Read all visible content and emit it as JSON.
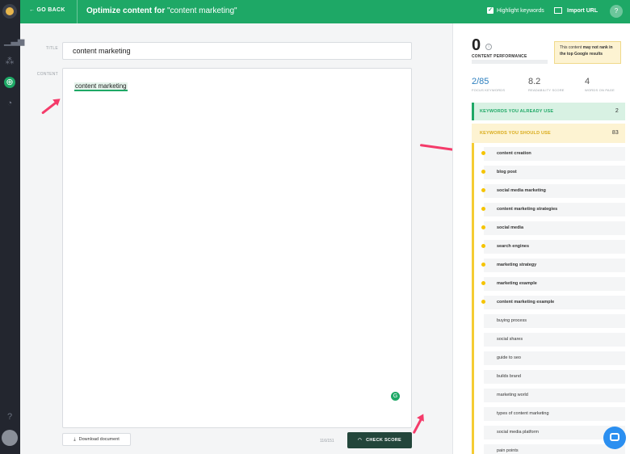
{
  "topbar": {
    "go_back": "GO BACK",
    "title_prefix": "Optimize content for ",
    "title_keyword": "\"content marketing\"",
    "highlight_keywords": "Highlight keywords",
    "import_url": "Import URL",
    "help": "?"
  },
  "editor": {
    "title_label": "TITLE",
    "title_value": "content marketing",
    "content_label": "CONTENT",
    "content_value": "content marketing",
    "download_button": "Download document",
    "counter": "116/151",
    "check_score_button": "CHECK SCORE"
  },
  "panel": {
    "score": "0",
    "score_label": "CONTENT PERFORMANCE",
    "tooltip_prefix": "This content ",
    "tooltip_bold": "may not rank in the top Google results",
    "stats": [
      {
        "value": "2/85",
        "label": "FOCUS KEYWORDS"
      },
      {
        "value": "8.2",
        "label": "READABILITY SCORE"
      },
      {
        "value": "4",
        "label": "WORDS ON PAGE"
      }
    ],
    "already_use_label": "KEYWORDS YOU ALREADY USE",
    "already_use_count": "2",
    "should_use_label": "KEYWORDS YOU SHOULD USE",
    "should_use_count": "83",
    "keywords": [
      {
        "text": "content creation",
        "priority": true
      },
      {
        "text": "blog post",
        "priority": true
      },
      {
        "text": "social media marketing",
        "priority": true
      },
      {
        "text": "content marketing strategies",
        "priority": true
      },
      {
        "text": "social media",
        "priority": true
      },
      {
        "text": "search engines",
        "priority": true
      },
      {
        "text": "marketing strategy",
        "priority": true
      },
      {
        "text": "marketing example",
        "priority": true
      },
      {
        "text": "content marketing example",
        "priority": true
      },
      {
        "text": "buying process",
        "priority": false
      },
      {
        "text": "social shares",
        "priority": false
      },
      {
        "text": "guide to seo",
        "priority": false
      },
      {
        "text": "builds brand",
        "priority": false
      },
      {
        "text": "marketing world",
        "priority": false
      },
      {
        "text": "types of content marketing",
        "priority": false
      },
      {
        "text": "social media platform",
        "priority": false
      },
      {
        "text": "pain points",
        "priority": false
      }
    ]
  },
  "colors": {
    "brand_green": "#1ea866",
    "annotation_arrow": "#f43b6a",
    "should_use_yellow": "#f5cc33"
  }
}
